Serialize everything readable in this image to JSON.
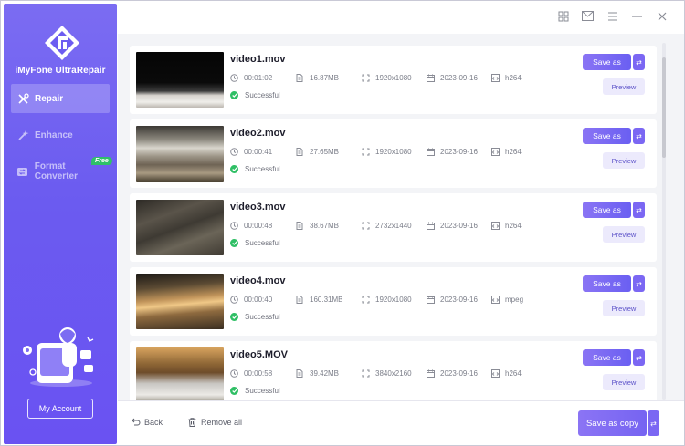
{
  "app": {
    "name": "iMyFone UltraRepair"
  },
  "sidebar": {
    "items": [
      {
        "label": "Repair",
        "icon": "repair-tools-icon",
        "active": true
      },
      {
        "label": "Enhance",
        "icon": "magic-wand-icon",
        "active": false
      },
      {
        "label": "Format Converter",
        "icon": "format-convert-icon",
        "active": false,
        "badge": "Free"
      }
    ],
    "account_label": "My Account"
  },
  "titlebar": {
    "icons": [
      "grid-icon",
      "mail-icon",
      "menu-icon",
      "minimize-icon",
      "close-icon"
    ]
  },
  "videos": [
    {
      "name": "video1.mov",
      "duration": "00:01:02",
      "size": "16.87MB",
      "resolution": "1920x1080",
      "date": "2023-09-16",
      "codec": "h264",
      "status": "Successful"
    },
    {
      "name": "video2.mov",
      "duration": "00:00:41",
      "size": "27.65MB",
      "resolution": "1920x1080",
      "date": "2023-09-16",
      "codec": "h264",
      "status": "Successful"
    },
    {
      "name": "video3.mov",
      "duration": "00:00:48",
      "size": "38.67MB",
      "resolution": "2732x1440",
      "date": "2023-09-16",
      "codec": "h264",
      "status": "Successful"
    },
    {
      "name": "video4.mov",
      "duration": "00:00:40",
      "size": "160.31MB",
      "resolution": "1920x1080",
      "date": "2023-09-16",
      "codec": "mpeg",
      "status": "Successful"
    },
    {
      "name": "video5.MOV",
      "duration": "00:00:58",
      "size": "39.42MB",
      "resolution": "3840x2160",
      "date": "2023-09-16",
      "codec": "h264",
      "status": "Successful"
    }
  ],
  "row_actions": {
    "save_as": "Save as",
    "preview": "Preview"
  },
  "bottom": {
    "back": "Back",
    "remove_all": "Remove all",
    "save_as_copy": "Save as copy"
  },
  "colors": {
    "accent": "#6b5bf0",
    "success": "#2fbf65"
  }
}
